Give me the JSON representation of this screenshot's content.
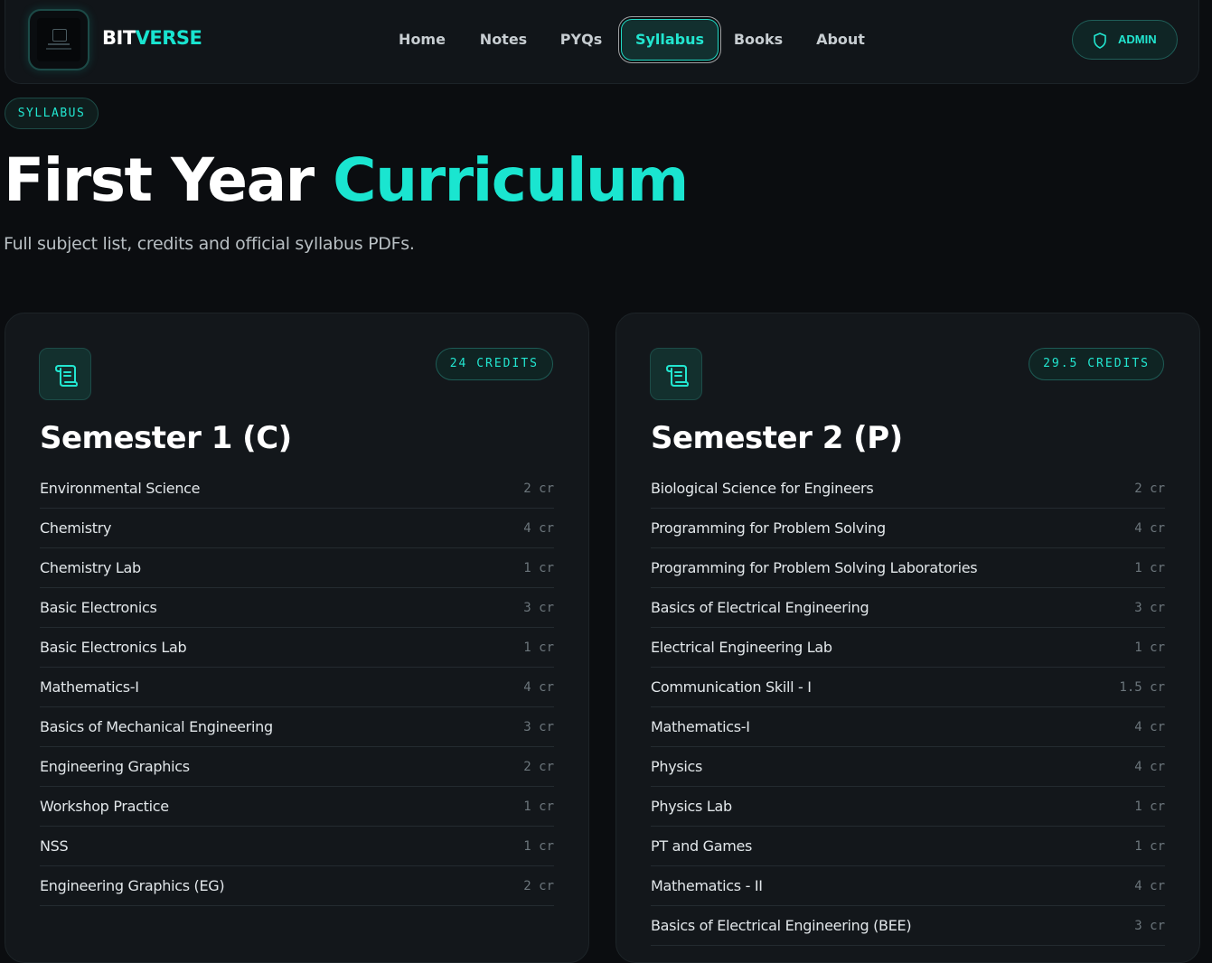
{
  "nav": {
    "brand_part1": "BIT",
    "brand_part2": "VERSE",
    "links": [
      {
        "label": "Home"
      },
      {
        "label": "Notes"
      },
      {
        "label": "PYQs"
      },
      {
        "label": "Syllabus",
        "active": true
      },
      {
        "label": "Books"
      },
      {
        "label": "About"
      }
    ],
    "admin_label": "ADMIN"
  },
  "hero": {
    "tag": "SYLLABUS",
    "title_part1": "First Year ",
    "title_part2": "Curriculum",
    "subtitle": "Full subject list, credits and official syllabus PDFs."
  },
  "semesters": [
    {
      "title": "Semester 1 (C)",
      "credits": "24 CREDITS",
      "subjects": [
        {
          "name": "Environmental Science",
          "cr": "2 cr"
        },
        {
          "name": "Chemistry",
          "cr": "4 cr"
        },
        {
          "name": "Chemistry Lab",
          "cr": "1 cr"
        },
        {
          "name": "Basic Electronics",
          "cr": "3 cr"
        },
        {
          "name": "Basic Electronics Lab",
          "cr": "1 cr"
        },
        {
          "name": "Mathematics-I",
          "cr": "4 cr"
        },
        {
          "name": "Basics of Mechanical Engineering",
          "cr": "3 cr"
        },
        {
          "name": "Engineering Graphics",
          "cr": "2 cr"
        },
        {
          "name": "Workshop Practice",
          "cr": "1 cr"
        },
        {
          "name": "NSS",
          "cr": "1 cr"
        },
        {
          "name": "Engineering Graphics (EG)",
          "cr": "2 cr"
        }
      ]
    },
    {
      "title": "Semester 2 (P)",
      "credits": "29.5 CREDITS",
      "subjects": [
        {
          "name": "Biological Science for Engineers",
          "cr": "2 cr"
        },
        {
          "name": "Programming for Problem Solving",
          "cr": "4 cr"
        },
        {
          "name": "Programming for Problem Solving Laboratories",
          "cr": "1 cr"
        },
        {
          "name": "Basics of Electrical Engineering",
          "cr": "3 cr"
        },
        {
          "name": "Electrical Engineering Lab",
          "cr": "1 cr"
        },
        {
          "name": "Communication Skill - I",
          "cr": "1.5 cr"
        },
        {
          "name": "Mathematics-I",
          "cr": "4 cr"
        },
        {
          "name": "Physics",
          "cr": "4 cr"
        },
        {
          "name": "Physics Lab",
          "cr": "1 cr"
        },
        {
          "name": "PT and Games",
          "cr": "1 cr"
        },
        {
          "name": "Mathematics - II",
          "cr": "4 cr"
        },
        {
          "name": "Basics of Electrical Engineering (BEE)",
          "cr": "3 cr"
        }
      ]
    }
  ],
  "icons": {
    "logo": "bitverse-logo",
    "admin": "shield-icon",
    "semester": "scroll-icon"
  },
  "colors": {
    "accent": "#1ae5d0",
    "background": "#0b0d10",
    "card": "#13171b"
  }
}
